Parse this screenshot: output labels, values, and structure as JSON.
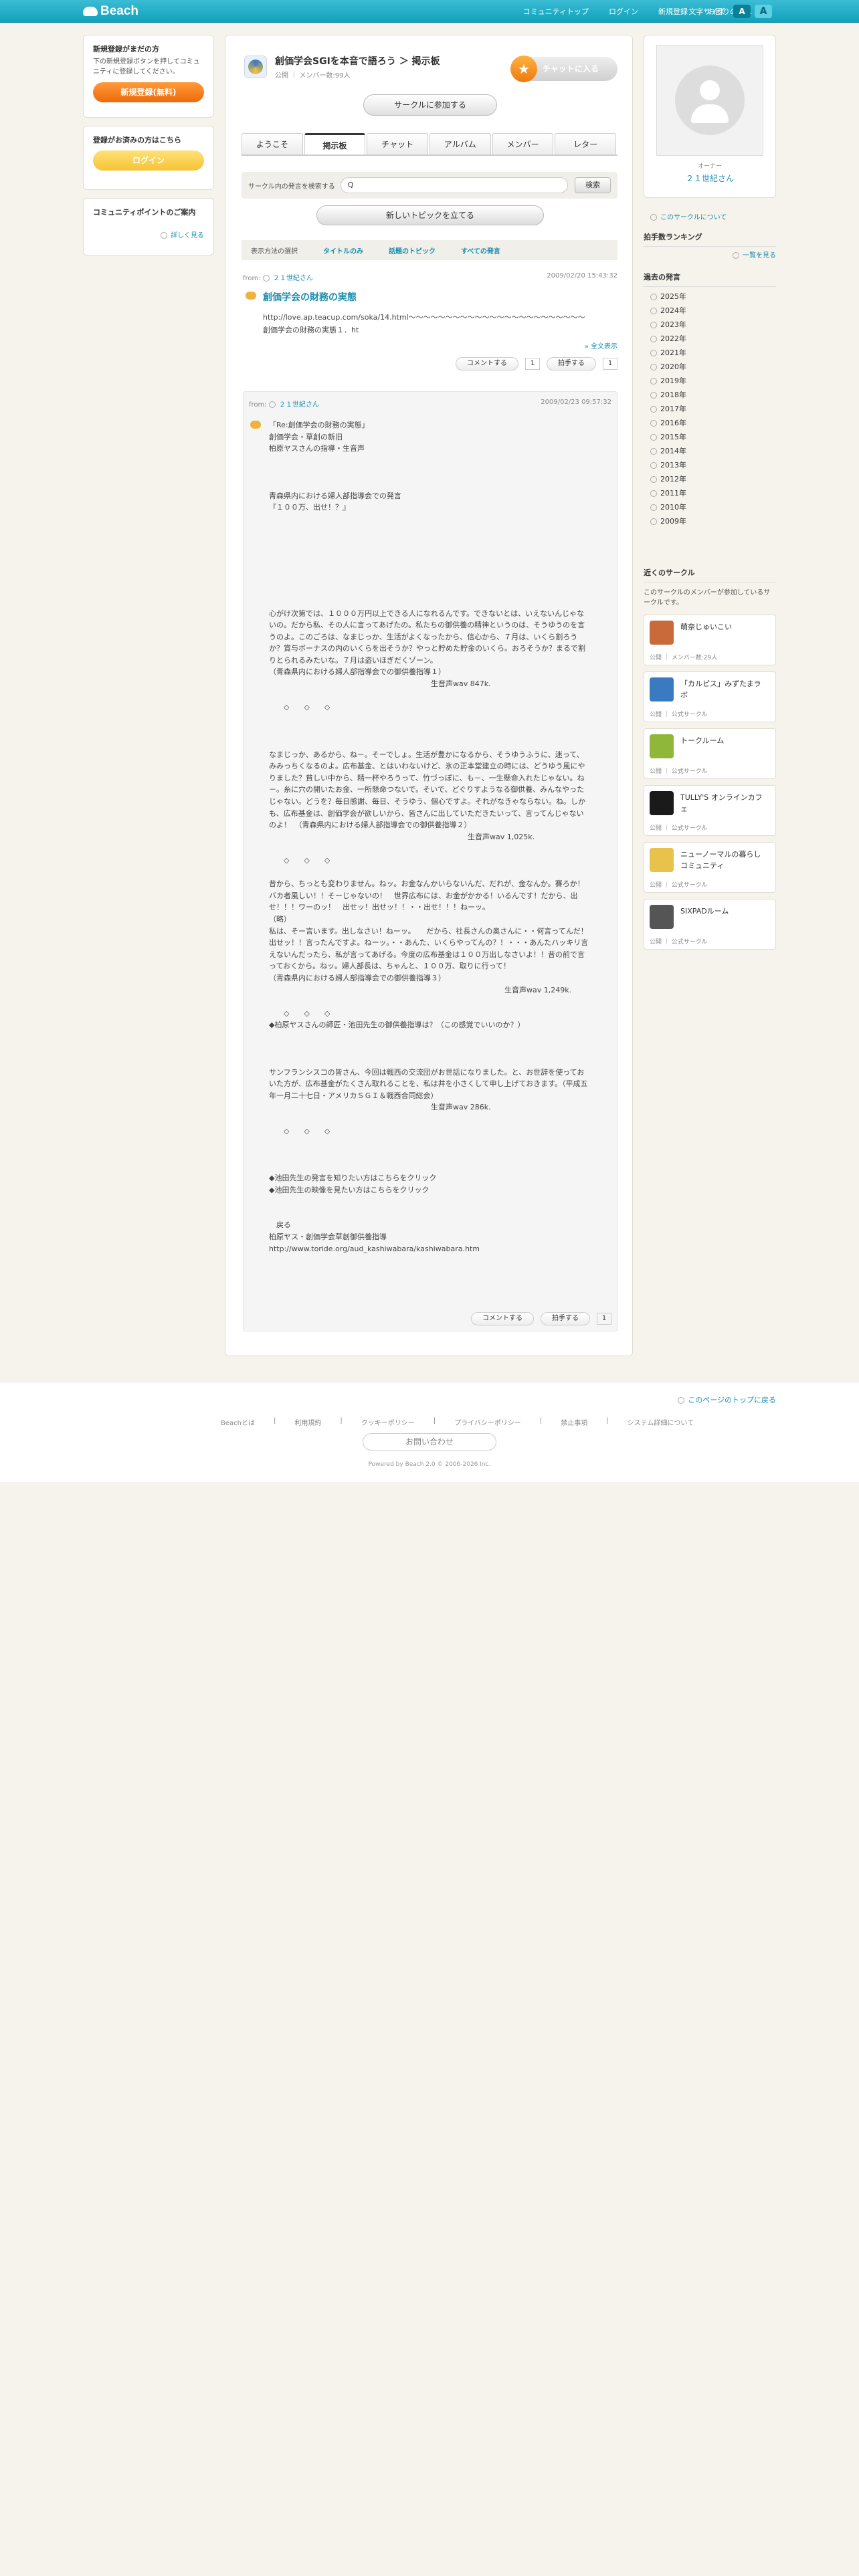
{
  "header": {
    "logo": "Beach",
    "nav": [
      "コミュニティトップ",
      "ログイン",
      "新規登録",
      "お困りの方へ"
    ],
    "font_label": "文字サイズ",
    "font_small": "A",
    "font_large": "A"
  },
  "left": {
    "reg_title": "新規登録がまだの方",
    "reg_desc": "下の新規登録ボタンを押してコミュニティに登録してください。",
    "reg_btn": "新規登録(無料)",
    "login_title": "登録がお済みの方はこちら",
    "login_btn": "ログイン",
    "points_title": "コミュニティポイントのご案内",
    "points_more": "詳しく見る"
  },
  "circle": {
    "title": "創価学会SGIを本音で語ろう ＞ 掲示板",
    "type": "公開",
    "members": "メンバー数:99人",
    "chat_btn": "チャットに入る",
    "join_btn": "サークルに参加する"
  },
  "tabs": [
    "ようこそ",
    "掲示板",
    "チャット",
    "アルバム",
    "メンバー",
    "レター"
  ],
  "search": {
    "label": "サークル内の発言を検索する",
    "value": "Q",
    "button": "検索"
  },
  "new_topic": "新しいトピックを立てる",
  "filter": {
    "label": "表示方法の選択",
    "options": [
      "タイトルのみ",
      "話題のトピック",
      "すべての発言"
    ]
  },
  "topic": {
    "from": "from:",
    "user": "２１世紀さん",
    "date": "2009/02/20 15:43:32",
    "title": "創価学会の財務の実態",
    "body": "http://love.ap.teacup.com/soka/14.html～～～～～～～～～～～～～～～～～～～～～～～～創価学会の財務の実態１．ht",
    "full": "» 全文表示",
    "comment": "コメントする",
    "praise": "拍手する",
    "comment_count": "1",
    "praise_count": "1"
  },
  "reply": {
    "from": "from:",
    "user": "２１世紀さん",
    "date": "2009/02/23 09:57:32",
    "body": "「Re:創価学会の財務の実態」\n創価学会・草創の新旧\n柏原ヤスさんの指導・生音声\n\n\n\n青森県内における婦人部指導会での発言\n『１００万、出せ！？』\n\n\n\n\n\n\n\n\n心がけ次第では、１０００万円以上できる人になれるんです。できないとは、いえないんじゃないの。だから私、その人に言ってあげたの。私たちの御供養の精神というのは、そうゆうのを言うのよ。このごろは、なまじっか、生活がよくなったから、信心から、７月は、いくら割ろうか？賞与ボーナスの内のいくらを出そうか？やっと貯めた貯金のいくら。おろそうか？まるで割りとられるみたいな。７月は盗いほぎだくゾーン。\n（青森県内における婦人部指導会での御供養指導１）\n　　　　　　　　　　　　　　　　　　　　　　生音声wav 847k.\n\n　　◇　　◇　　◇\n\n\n\nなまじっか、あるから、ね－。そーでしょ。生活が豊かになるから、そうゆうふうに、迷って、みみっちくなるのよ。広布基金、とはいわないけど、氷の正本堂建立の時には、どうゆう風にやりました？貧しい中から、精一杯やろうって、竹づっぽに、も－、一生懸命入れたじゃない。ね－。糸に穴の開いたお金、一所懸命つないで。そいで、どぐりすようなる御供養、みんなやったじゃない。どうを？毎日感謝、毎日、そうゆう、個心ですよ。それがなきゃならない。ね。しかも、広布基金は、創価学会が欲しいから、皆さんに出していただきたいって、言ってんじゃないのよ！　（青森県内における婦人部指導会での御供養指導２）\n　　　　　　　　　　　　　　　　　　　　　　　　　　　生音声wav 1,025k.\n\n　　◇　　◇　　◇\n\n昔から、ちっとも変わりません。ねッ。お金なんかいらないんだ、だれが、金なんか。賽ろか！バカ者風しい！！そーじゃないの！　世界広布には、お金がかかる！いるんです！だから、出せ！！！ワーのッ！　出せッ！出せッ！！・・出せ！！！ねーッ。\n（略）\n私は、そー言います。出しなさい！ねーッ。　　だから、社長さんの奥さんに・・何言ってんだ！出せッ！！言ったんですよ。ねーッ。・・あんた、いくらやってんの？！・・・あんたハッキリ言えないんだったら、私が言ってあげる。今度の広布基金は１００万出しなさいよ！！昔の前で言っておくから。ねッ。婦人部長は、ちゃんと、１００万、取りに行って！\n（青森県内における婦人部指導会での御供養指導３）\n　　　　　　　　　　　　　　　　　　　　　　　　　　　　　　　　生音声wav 1,249k.\n\n　　◇　　◇　　◇\n◆柏原ヤスさんの師匠・池田先生の御供養指導は？（この感覚でいいのか？）\n\n\n\nサンフランシスコの皆さん、今回は戦西の交流団がお世話になりました。と、お世辞を使っておいた方が、広布基金がたくさん取れることを、私は井を小さくして申し上げておきます。（平成五年一月二十七日・アメリカＳＧＩ＆戦西合同総会）\n　　　　　　　　　　　　　　　　　　　　　　生音声wav 286k.\n\n　　◇　　◇　　◇\n\n\n\n◆池田先生の発言を知りたい方はこちらをクリック\n◆池田先生の映像を見たい方はこちらをクリック\n\n\n　戻る\n柏原ヤス・創価学会草創御供養指導\nhttp://www.toride.org/aud_kashiwabara/kashiwabara.htm",
    "comment": "コメントする",
    "praise": "拍手する",
    "praise_count": "1"
  },
  "right": {
    "owner_label": "オーナー",
    "owner_name": "２１世紀さん",
    "circle_link": "このサークルについて",
    "ranking_title": "拍手数ランキング",
    "ranking_more": "一覧を見る",
    "past_title": "過去の発言",
    "years": [
      "2025年",
      "2024年",
      "2023年",
      "2022年",
      "2021年",
      "2020年",
      "2019年",
      "2018年",
      "2017年",
      "2016年",
      "2015年",
      "2014年",
      "2013年",
      "2012年",
      "2011年",
      "2010年",
      "2009年"
    ],
    "near_title": "近くのサークル",
    "near_desc": "このサークルのメンバーが参加しているサークルです。",
    "near": [
      {
        "name": "萌奈じゅいこい",
        "sub": "公開 ｜ メンバー数:29人",
        "icon": "#c86a3a"
      },
      {
        "name": "「カルピス」みずたまラボ",
        "sub": "公開 ｜ 公式サークル",
        "icon": "#3a7ac0"
      },
      {
        "name": "トークルーム",
        "sub": "公開 ｜ 公式サークル",
        "icon": "#8fb83a"
      },
      {
        "name": "TULLY'S オンラインカフェ",
        "sub": "公開 ｜ 公式サークル",
        "icon": "#1a1a1a"
      },
      {
        "name": "ニューノーマルの暮らし コミュニティ",
        "sub": "公開 ｜ 公式サークル",
        "icon": "#e8c24a"
      },
      {
        "name": "SIXPADルーム",
        "sub": "公開 ｜ 公式サークル",
        "icon": "#555555"
      }
    ]
  },
  "footer": {
    "pagetop": "このページのトップに戻る",
    "links": [
      "Beachとは",
      "利用規約",
      "クッキーポリシー",
      "プライバシーポリシー",
      "禁止事項",
      "システム詳細について"
    ],
    "contact": "お問い合わせ",
    "copyright": "Powered by Beach 2.0 © 2006-2026 Inc."
  }
}
